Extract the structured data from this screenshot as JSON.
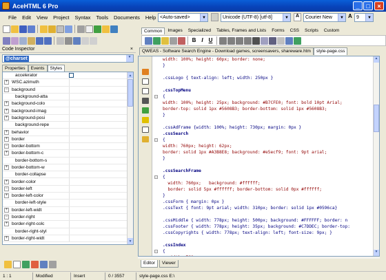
{
  "window": {
    "title": "AceHTML 6 Pro",
    "minimize": "_",
    "maximize": "□",
    "close": "×"
  },
  "menu": [
    "File",
    "Edit",
    "View",
    "Project",
    "Syntax",
    "Tools",
    "Documents",
    "Help"
  ],
  "toolbar": {
    "mode_combo": "<Auto-saved>",
    "encoding_combo": "Unicode (UTF-8) [utf-8]",
    "font_combo": "Courier New",
    "size_combo": "9",
    "bold": "B",
    "italic": "I",
    "underline": "U"
  },
  "ribbon_tabs": [
    "Common",
    "Images",
    "Specialized",
    "Tables, Frames and Lists",
    "Forms",
    "CSS",
    "Scripts",
    "Custom"
  ],
  "ribbon_active": "Common",
  "left_panel": {
    "title": "Code Inspector",
    "tag_selected": "@charset",
    "tabs": [
      "Properties",
      "Events",
      "Styles"
    ],
    "active_tab": "Styles",
    "properties": [
      {
        "label": "accelerator",
        "expander": "",
        "checkbox": true
      },
      {
        "label": "WSC.azimuth",
        "expander": "+"
      },
      {
        "label": "background",
        "expander": "-"
      },
      {
        "label": "background-atta",
        "expander": ""
      },
      {
        "label": "background-colo",
        "expander": "+"
      },
      {
        "label": "background-imag",
        "expander": "+"
      },
      {
        "label": "background-posi",
        "expander": "+"
      },
      {
        "label": "background-repe",
        "expander": ""
      },
      {
        "label": "behavior",
        "expander": "+"
      },
      {
        "label": "border",
        "expander": "+"
      },
      {
        "label": "border-bottom",
        "expander": "-"
      },
      {
        "label": "border-bottom-c",
        "expander": "+"
      },
      {
        "label": "border-bottom-s",
        "expander": ""
      },
      {
        "label": "border-bottom-w",
        "expander": "+"
      },
      {
        "label": "border-collapse",
        "expander": ""
      },
      {
        "label": "border-color",
        "expander": "+"
      },
      {
        "label": "border-left",
        "expander": "-"
      },
      {
        "label": "border-left-color",
        "expander": "+"
      },
      {
        "label": "border-left-style",
        "expander": ""
      },
      {
        "label": "border-left-widt",
        "expander": "+"
      },
      {
        "label": "border-right",
        "expander": "-"
      },
      {
        "label": "border-right-colc",
        "expander": "+"
      },
      {
        "label": "border-right-styl",
        "expander": ""
      },
      {
        "label": "border-right-widt",
        "expander": "+"
      }
    ]
  },
  "doc_tabs": [
    "QWEAS - Software Search Engine - Download games, screensavers, shareware.htm",
    "style-page.css"
  ],
  "doc_active": "style-page.css",
  "code_lines": [
    [
      {
        "t": "width: 100%; height: 60px; border: none;",
        "c": "r"
      }
    ],
    [
      {
        "t": "}",
        "c": ""
      }
    ],
    [
      {
        "t": "",
        "c": ""
      }
    ],
    [
      {
        "t": ".cssLogo { text-align: left; width: 250px }",
        "c": ""
      }
    ],
    [
      {
        "t": "",
        "c": ""
      }
    ],
    [
      {
        "t": ".cssTopMenu",
        "c": "k"
      }
    ],
    [
      {
        "t": "{",
        "c": ""
      }
    ],
    [
      {
        "t": "width: 100%; height: 25px; background: #B7CFE0; font: bold 10pt Arial;",
        "c": "r"
      }
    ],
    [
      {
        "t": "border-top: solid 1px #5608B3; border-bottom: solid 1px #5608B3;",
        "c": "r"
      }
    ],
    [
      {
        "t": "}",
        "c": ""
      }
    ],
    [
      {
        "t": "",
        "c": ""
      }
    ],
    [
      {
        "t": ".cssAdFrame {width: 100%; height: 730px; margin: 0px }",
        "c": ""
      }
    ],
    [
      {
        "t": ".cssSearch",
        "c": "k"
      }
    ],
    [
      {
        "t": "{",
        "c": ""
      }
    ],
    [
      {
        "t": "width: 760px; height: 62px;",
        "c": "r"
      }
    ],
    [
      {
        "t": "border: solid 1px #A3B8E8; background: #e5ecf9; font: 9pt arial;",
        "c": "r"
      }
    ],
    [
      {
        "t": "}",
        "c": ""
      }
    ],
    [
      {
        "t": "",
        "c": ""
      }
    ],
    [
      {
        "t": ".cssSearchFrame",
        "c": "k"
      }
    ],
    [
      {
        "t": "{",
        "c": ""
      }
    ],
    [
      {
        "t": "  width: 760px;   background: #ffffff;",
        "c": "r"
      }
    ],
    [
      {
        "t": "  border: solid 5px #ffffff; border-bottom: solid 0px #ffffff;",
        "c": "r"
      }
    ],
    [
      {
        "t": "}",
        "c": ""
      }
    ],
    [
      {
        "t": ".cssForm { margin: 0px }",
        "c": ""
      }
    ],
    [
      {
        "t": ".cssText { font: 9pt arial; width: 310px; border: solid 1px #0596ca}",
        "c": ""
      }
    ],
    [
      {
        "t": "",
        "c": ""
      }
    ],
    [
      {
        "t": ".cssMiddle { width: 778px; height: 500px; background: #FFFFFF; border: n",
        "c": ""
      }
    ],
    [
      {
        "t": ".cssFooter { width: 778px; height: 35px; background: #C7DDEC; border-top:",
        "c": ""
      }
    ],
    [
      {
        "t": ".cssCopyrights { width: 778px; text-align: left; font-size: 9px; }",
        "c": ""
      }
    ],
    [
      {
        "t": "",
        "c": ""
      }
    ],
    [
      {
        "t": ".cssIndex",
        "c": "k"
      }
    ],
    [
      {
        "t": "{",
        "c": ""
      }
    ],
    [
      {
        "t": "  width: 760px;",
        "c": "r"
      }
    ]
  ],
  "editor_tabs": [
    "Editor",
    "Viewer"
  ],
  "editor_active": "Editor",
  "status": {
    "pos": "1 : 1",
    "modified": "Modified",
    "mode": "Insert",
    "count": "0 / 3557",
    "file": "style-page.css  E:\\"
  }
}
